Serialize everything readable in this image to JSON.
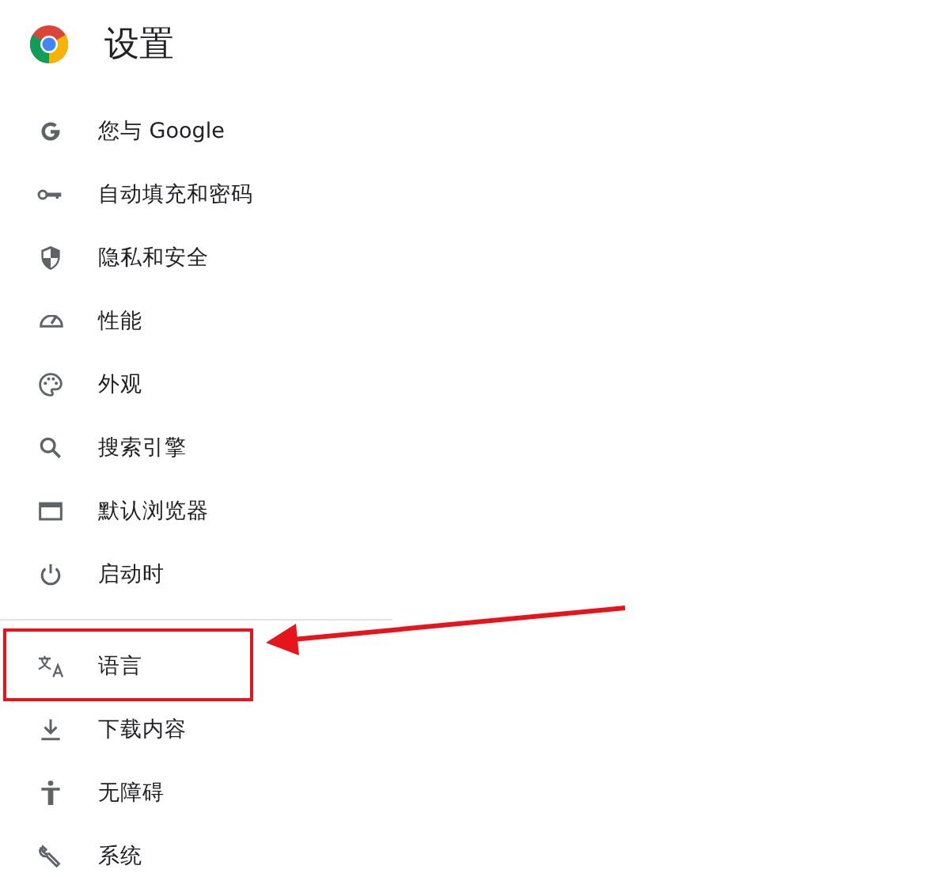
{
  "header": {
    "title": "设置"
  },
  "menu": [
    {
      "label": "您与 Google",
      "kind": "google",
      "separator_before": false,
      "highlighted": false
    },
    {
      "label": "自动填充和密码",
      "kind": "key",
      "separator_before": false,
      "highlighted": false
    },
    {
      "label": "隐私和安全",
      "kind": "shield",
      "separator_before": false,
      "highlighted": false
    },
    {
      "label": "性能",
      "kind": "gauge",
      "separator_before": false,
      "highlighted": false
    },
    {
      "label": "外观",
      "kind": "palette",
      "separator_before": false,
      "highlighted": false
    },
    {
      "label": "搜索引擎",
      "kind": "search",
      "separator_before": false,
      "highlighted": false
    },
    {
      "label": "默认浏览器",
      "kind": "window",
      "separator_before": false,
      "highlighted": false
    },
    {
      "label": "启动时",
      "kind": "power",
      "separator_before": false,
      "highlighted": false
    },
    {
      "label": "语言",
      "kind": "translate",
      "separator_before": true,
      "highlighted": true
    },
    {
      "label": "下载内容",
      "kind": "download",
      "separator_before": false,
      "highlighted": false
    },
    {
      "label": "无障碍",
      "kind": "person",
      "separator_before": false,
      "highlighted": false
    },
    {
      "label": "系统",
      "kind": "wrench",
      "separator_before": false,
      "highlighted": false
    }
  ]
}
